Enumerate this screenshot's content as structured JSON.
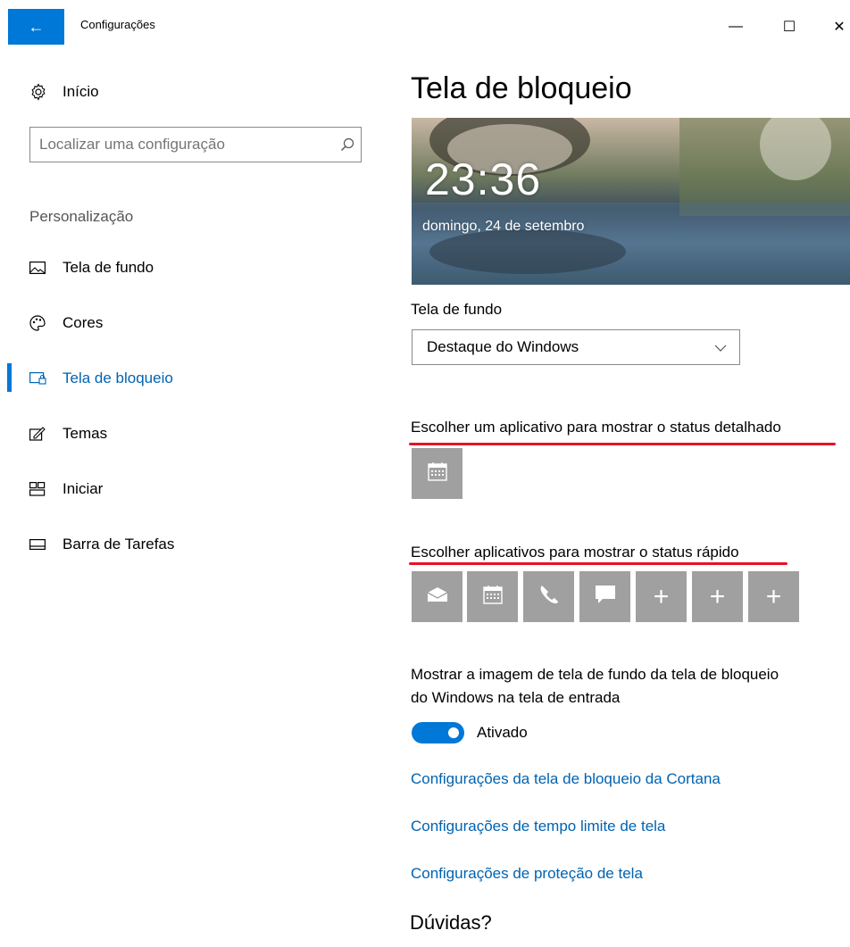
{
  "window": {
    "title": "Configurações",
    "back_label": "←",
    "minimize_label": "—",
    "maximize_label": "☐",
    "close_label": "✕"
  },
  "sidebar": {
    "home_label": "Início",
    "search_placeholder": "Localizar uma configuração",
    "section_label": "Personalização",
    "items": [
      {
        "label": "Tela de fundo",
        "icon": "picture-icon"
      },
      {
        "label": "Cores",
        "icon": "palette-icon"
      },
      {
        "label": "Tela de bloqueio",
        "icon": "lock-screen-icon",
        "active": true
      },
      {
        "label": "Temas",
        "icon": "themes-icon"
      },
      {
        "label": "Iniciar",
        "icon": "start-icon"
      },
      {
        "label": "Barra de Tarefas",
        "icon": "taskbar-icon"
      }
    ]
  },
  "main": {
    "title": "Tela de bloqueio",
    "preview": {
      "time": "23:36",
      "date": "domingo, 24 de setembro"
    },
    "background_label": "Tela de fundo",
    "background_value": "Destaque do Windows",
    "detailed_status_label": "Escolher um aplicativo para mostrar o status detalhado",
    "quick_status_label": "Escolher aplicativos para mostrar o status rápido",
    "quick_tiles": [
      {
        "icon": "mail-icon"
      },
      {
        "icon": "calendar-icon"
      },
      {
        "icon": "phone-icon"
      },
      {
        "icon": "message-icon"
      },
      {
        "icon": "plus-icon",
        "text": "+"
      },
      {
        "icon": "plus-icon",
        "text": "+"
      },
      {
        "icon": "plus-icon",
        "text": "+"
      }
    ],
    "show_bg_description": "Mostrar a imagem de tela de fundo da tela de bloqueio do Windows na tela de entrada",
    "toggle_state": "Ativado",
    "links": [
      "Configurações da tela de bloqueio da Cortana",
      "Configurações de tempo limite de tela",
      "Configurações de proteção de tela"
    ],
    "help_title": "Dúvidas?"
  },
  "colors": {
    "accent": "#0078d7",
    "link": "#0063b1",
    "tile": "#a0a0a0",
    "annotation_underline": "#e81123"
  }
}
